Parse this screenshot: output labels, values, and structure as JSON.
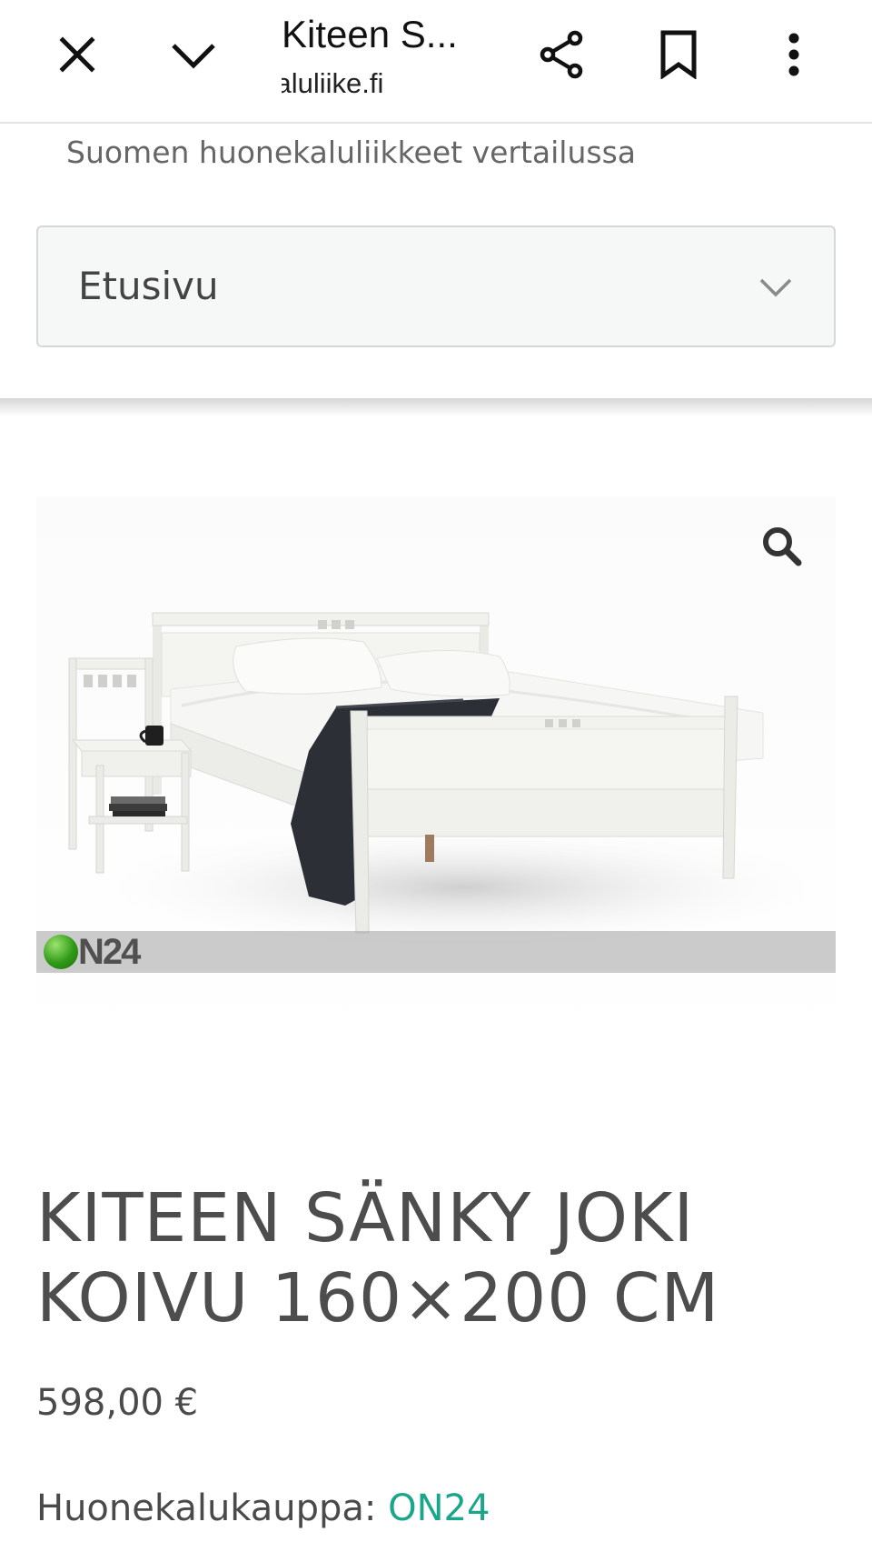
{
  "toolbar": {
    "title": "Kiteen S...",
    "url": "kaluliike.fi"
  },
  "header": {
    "tagline": "Suomen huonekaluliikkeet vertailussa",
    "nav_selected": "Etusivu"
  },
  "product": {
    "watermark_text": "N24",
    "title": "KITEEN SÄNKY JOKI KOIVU 160×200 CM",
    "price": "598,00 €",
    "store_label": "Huonekalukauppa:",
    "store_name": "ON24"
  },
  "colors": {
    "link": "#1aa68a",
    "text": "#4a4a4a",
    "select_bg": "#f6f7f7"
  },
  "icons": [
    "close-icon",
    "chevron-down-icon",
    "share-icon",
    "bookmark-icon",
    "more-vert-icon",
    "search-icon"
  ]
}
